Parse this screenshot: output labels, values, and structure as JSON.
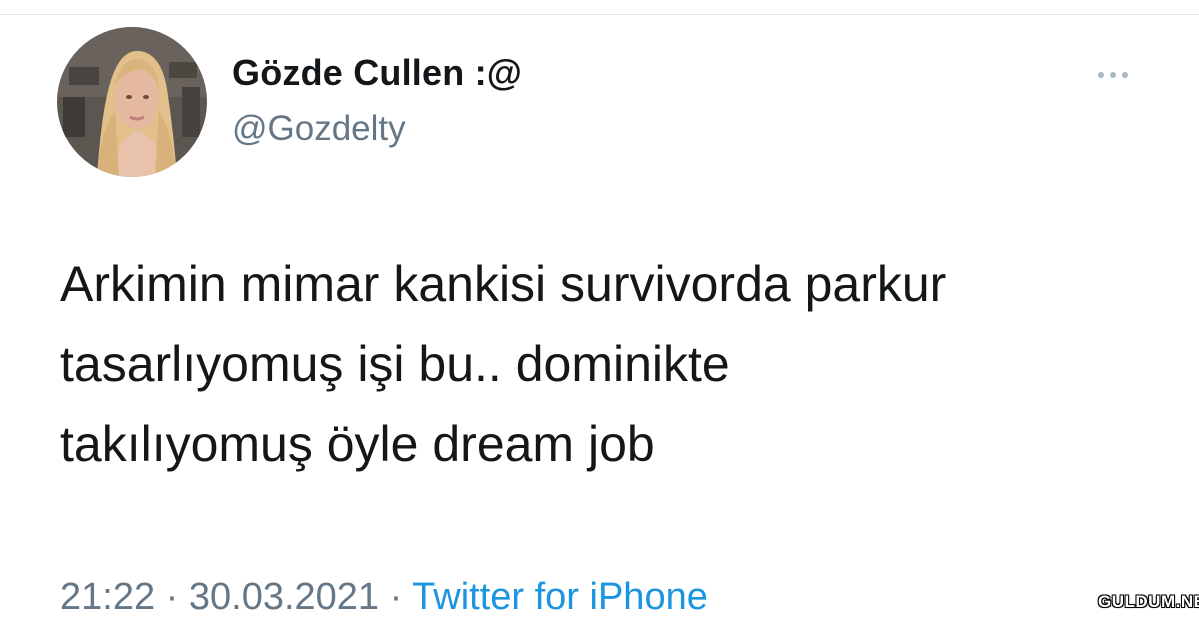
{
  "tweet": {
    "display_name": "Gözde Cullen :@",
    "handle": "@Gozdelty",
    "text_lines": [
      "Arkimin mimar kankisi survivorda parkur",
      "tasarlıyomuş işi bu.. dominikte",
      "takılıyomuş öyle dream job"
    ],
    "time": "21:22",
    "separator": " · ",
    "date": "30.03.2021",
    "source": "Twitter for iPhone"
  },
  "icons": {
    "more": "more-horizontal-icon",
    "avatar": "profile-photo"
  },
  "watermark": "GULDUM.NET",
  "colors": {
    "text_primary": "#14171a",
    "text_secondary": "#657786",
    "link": "#1b95e0",
    "background": "#ffffff"
  }
}
